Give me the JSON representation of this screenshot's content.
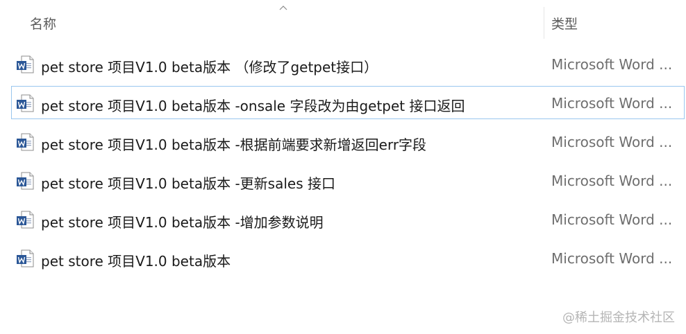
{
  "header": {
    "name_label": "名称",
    "type_label": "类型",
    "sort_icon": "chevron-up-icon"
  },
  "files": [
    {
      "name": "pet store 项目V1.0 beta版本 （修改了getpet接口）",
      "type": "Microsoft Word ...",
      "icon": "word-document-icon",
      "selected": false
    },
    {
      "name": "pet store 项目V1.0 beta版本 -onsale 字段改为由getpet 接口返回",
      "type": "Microsoft Word ...",
      "icon": "word-document-icon",
      "selected": true
    },
    {
      "name": "pet store 项目V1.0 beta版本 -根据前端要求新增返回err字段",
      "type": "Microsoft Word ...",
      "icon": "word-document-icon",
      "selected": false
    },
    {
      "name": "pet store 项目V1.0 beta版本 -更新sales 接口",
      "type": "Microsoft Word ...",
      "icon": "word-document-icon",
      "selected": false
    },
    {
      "name": "pet store 项目V1.0 beta版本 -增加参数说明",
      "type": "Microsoft Word ...",
      "icon": "word-document-icon",
      "selected": false
    },
    {
      "name": "pet store 项目V1.0 beta版本",
      "type": "Microsoft Word ...",
      "icon": "word-document-icon",
      "selected": false
    }
  ],
  "watermark": "@稀土掘金技术社区",
  "colors": {
    "word_blue": "#2b5797",
    "selection_border": "#99c6ee"
  }
}
